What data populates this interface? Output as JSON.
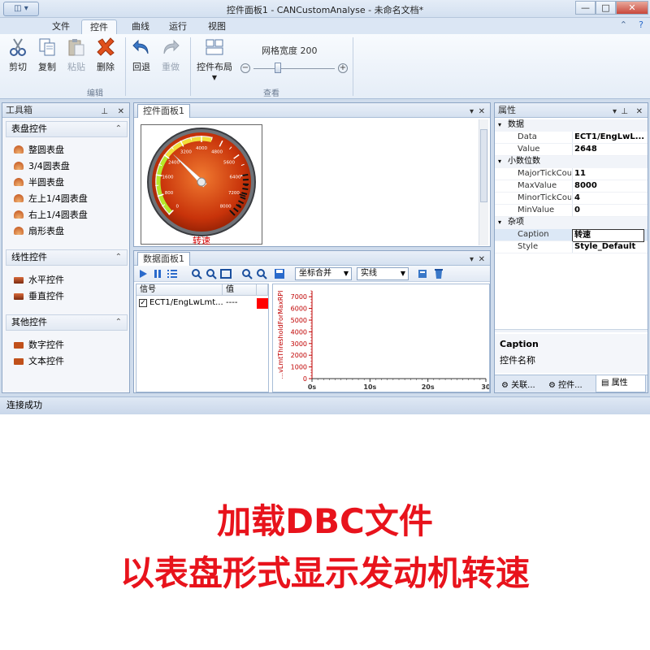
{
  "window": {
    "title": "控件面板1 - CANCustomAnalyse - 未命名文档*"
  },
  "menu_tabs": [
    "文件",
    "控件",
    "曲线",
    "运行",
    "视图"
  ],
  "ribbon": {
    "cut": "剪切",
    "copy": "复制",
    "paste": "粘贴",
    "delete": "删除",
    "undo": "回退",
    "redo": "重做",
    "layout": "控件布局",
    "grid_width_label": "网格宽度 200",
    "group_edit": "编辑",
    "group_view": "查看"
  },
  "toolbox": {
    "title": "工具箱",
    "sections": [
      {
        "title": "表盘控件",
        "items": [
          "整圆表盘",
          "3/4圆表盘",
          "半圆表盘",
          "左上1/4圆表盘",
          "右上1/4圆表盘",
          "扇形表盘"
        ]
      },
      {
        "title": "线性控件",
        "items": [
          "水平控件",
          "垂直控件"
        ]
      },
      {
        "title": "其他控件",
        "items": [
          "数字控件",
          "文本控件"
        ]
      }
    ]
  },
  "control_panel": {
    "tab": "控件面板1",
    "gauge": {
      "label": "转速",
      "value": 2648,
      "min": 0,
      "max": 8000,
      "ticks": [
        "0",
        "400",
        "800",
        "1200",
        "1600",
        "2000",
        "2400",
        "2800",
        "3200",
        "3600",
        "4000",
        "4400",
        "4800",
        "5200",
        "5600",
        "6000",
        "6400",
        "6800",
        "7200",
        "7600",
        "8000"
      ],
      "shown_ticks": [
        "0",
        "800",
        "1600",
        "2400",
        "3200",
        "4000",
        "4800",
        "5600",
        "6400",
        "7200",
        "8000"
      ]
    }
  },
  "data_panel": {
    "tab": "数据面板1",
    "combo_axis": "坐标合并",
    "combo_line": "实线",
    "columns": [
      "信号",
      "值"
    ],
    "rows": [
      {
        "name": "ECT1/EngLwLmt...",
        "value": "----",
        "color": "#ff0000"
      }
    ],
    "chart_data": {
      "type": "line",
      "ylabel": "...vLmtThresholdForMaxRPI",
      "y_ticks": [
        "0",
        "1000",
        "2000",
        "3000",
        "4000",
        "5000",
        "6000",
        "7000"
      ],
      "x_ticks": [
        "0s",
        "10s",
        "20s",
        "30"
      ],
      "ylim": [
        0,
        7500
      ],
      "xlim": [
        0,
        30
      ],
      "series": [
        {
          "name": "ECT1/EngLwLmt...",
          "values": []
        }
      ]
    }
  },
  "properties": {
    "title": "属性",
    "categories": [
      {
        "name": "数据",
        "rows": [
          {
            "k": "Data",
            "v": "ECT1/EngLwL..."
          },
          {
            "k": "Value",
            "v": "2648"
          }
        ]
      },
      {
        "name": "小数位数",
        "rows": [
          {
            "k": "MajorTickCour",
            "v": "11"
          },
          {
            "k": "MaxValue",
            "v": "8000"
          },
          {
            "k": "MinorTickCour",
            "v": "4"
          },
          {
            "k": "MinValue",
            "v": "0"
          }
        ]
      },
      {
        "name": "杂项",
        "rows": [
          {
            "k": "Caption",
            "v": "转速"
          },
          {
            "k": "Style",
            "v": "Style_Default"
          }
        ]
      }
    ],
    "help_title": "Caption",
    "help_text": "控件名称",
    "bottom_tabs": [
      "关联...",
      "控件...",
      "属性"
    ]
  },
  "status": "连接成功",
  "captions": [
    "加载DBC文件",
    "以表盘形式显示发动机转速"
  ]
}
